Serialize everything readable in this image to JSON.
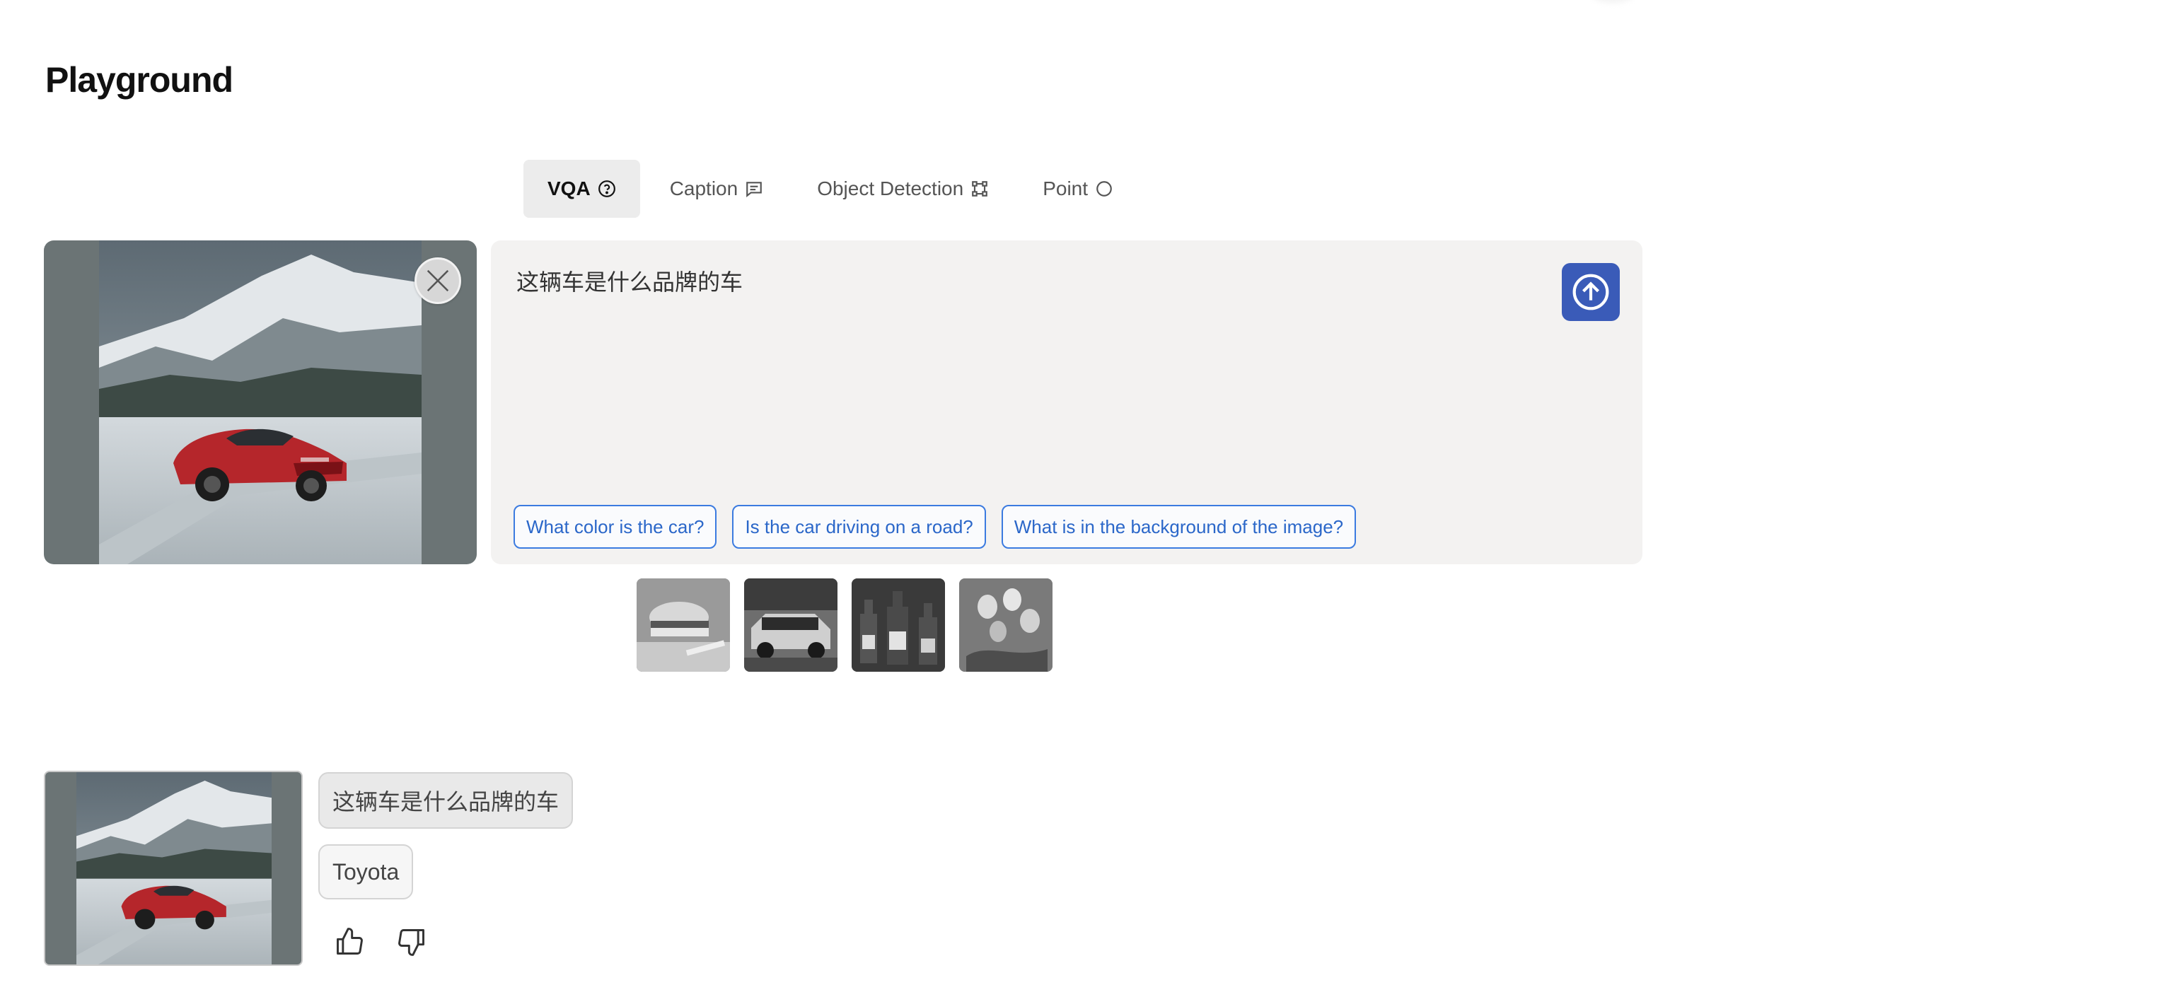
{
  "page": {
    "title": "Playground"
  },
  "tabs": [
    {
      "label": "VQA",
      "icon": "question-circle-icon",
      "active": true
    },
    {
      "label": "Caption",
      "icon": "message-square-icon",
      "active": false
    },
    {
      "label": "Object Detection",
      "icon": "bounding-box-icon",
      "active": false
    },
    {
      "label": "Point",
      "icon": "circle-icon",
      "active": false
    }
  ],
  "input": {
    "query": "这辆车是什么品牌的车",
    "send_icon": "arrow-up-circle-icon",
    "close_icon": "close-icon"
  },
  "suggestions": [
    "What color is the car?",
    "Is the car driving on a road?",
    "What is in the background of the image?"
  ],
  "samples": [
    {
      "icon": "burger-photo"
    },
    {
      "icon": "car-photo"
    },
    {
      "icon": "bottles-photo"
    },
    {
      "icon": "eggs-photo"
    }
  ],
  "history": {
    "question": "这辆车是什么品牌的车",
    "answer": "Toyota",
    "like_icon": "thumbs-up-icon",
    "dislike_icon": "thumbs-down-icon"
  },
  "colors": {
    "accent": "#3a5bb8",
    "chip_border": "#3b7be0",
    "panel_bg": "#f3f2f1",
    "active_tab_bg": "#ececec"
  }
}
